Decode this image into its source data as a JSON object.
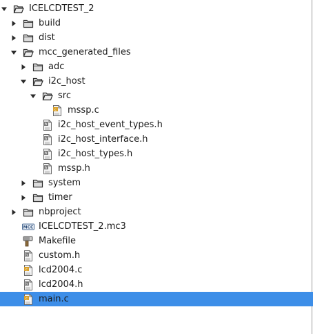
{
  "colors": {
    "selection": "#3d8ee8",
    "folder_stroke": "#2e2e2e",
    "folder_fill": "#dcdcdc",
    "source_badge": "#d9a02a"
  },
  "tree": [
    {
      "label": "ICELCDTEST_2",
      "depth": 0,
      "twisty": "expanded",
      "icon": "folder-open-icon"
    },
    {
      "label": "build",
      "depth": 1,
      "twisty": "collapsed",
      "icon": "folder-icon"
    },
    {
      "label": "dist",
      "depth": 1,
      "twisty": "collapsed",
      "icon": "folder-icon"
    },
    {
      "label": "mcc_generated_files",
      "depth": 1,
      "twisty": "expanded",
      "icon": "folder-open-icon"
    },
    {
      "label": "adc",
      "depth": 2,
      "twisty": "collapsed",
      "icon": "folder-icon"
    },
    {
      "label": "i2c_host",
      "depth": 2,
      "twisty": "expanded",
      "icon": "folder-open-icon"
    },
    {
      "label": "src",
      "depth": 3,
      "twisty": "expanded",
      "icon": "folder-open-icon"
    },
    {
      "label": "mssp.c",
      "depth": 4,
      "twisty": "none",
      "icon": "c-source-file-icon"
    },
    {
      "label": "i2c_host_event_types.h",
      "depth": 3,
      "twisty": "none",
      "icon": "header-file-icon"
    },
    {
      "label": "i2c_host_interface.h",
      "depth": 3,
      "twisty": "none",
      "icon": "header-file-icon"
    },
    {
      "label": "i2c_host_types.h",
      "depth": 3,
      "twisty": "none",
      "icon": "header-file-icon"
    },
    {
      "label": "mssp.h",
      "depth": 3,
      "twisty": "none",
      "icon": "header-file-icon"
    },
    {
      "label": "system",
      "depth": 2,
      "twisty": "collapsed",
      "icon": "folder-icon"
    },
    {
      "label": "timer",
      "depth": 2,
      "twisty": "collapsed",
      "icon": "folder-icon"
    },
    {
      "label": "nbproject",
      "depth": 1,
      "twisty": "collapsed",
      "icon": "folder-icon"
    },
    {
      "label": "ICELCDTEST_2.mc3",
      "depth": 1,
      "twisty": "none",
      "icon": "mcc-config-file-icon"
    },
    {
      "label": "Makefile",
      "depth": 1,
      "twisty": "none",
      "icon": "makefile-icon"
    },
    {
      "label": "custom.h",
      "depth": 1,
      "twisty": "none",
      "icon": "header-file-icon"
    },
    {
      "label": "lcd2004.c",
      "depth": 1,
      "twisty": "none",
      "icon": "c-source-file-icon"
    },
    {
      "label": "lcd2004.h",
      "depth": 1,
      "twisty": "none",
      "icon": "header-file-icon"
    },
    {
      "label": "main.c",
      "depth": 1,
      "twisty": "none",
      "icon": "c-source-file-icon",
      "selected": true
    }
  ]
}
